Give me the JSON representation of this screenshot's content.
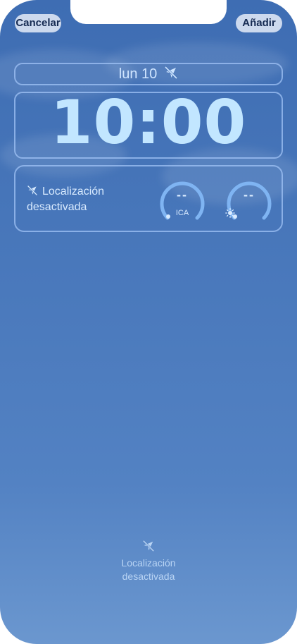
{
  "header": {
    "cancel_label": "Cancelar",
    "add_label": "Añadir"
  },
  "lockscreen": {
    "date": "lun 10",
    "time": "10:00"
  },
  "location_widget": {
    "icon": "location-off-icon",
    "line1": "Localización",
    "line2": "desactivada"
  },
  "gauges": {
    "aqi": {
      "value": "--",
      "label": "ICA"
    },
    "uv": {
      "value": "--",
      "icon": "sun-icon"
    }
  },
  "bottom_location": {
    "icon": "location-off-icon",
    "line1": "Localización",
    "line2": "desactivada"
  },
  "colors": {
    "accent": "#7fb4f2",
    "text_light": "#d9ebff"
  }
}
